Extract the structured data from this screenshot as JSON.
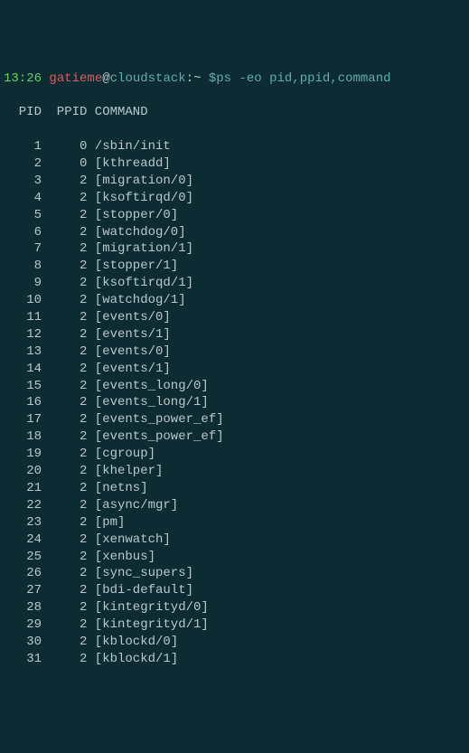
{
  "prompt": {
    "time": "13:26",
    "user": "gatieme",
    "at": "@",
    "host": "cloudstack",
    "path_sep": ":",
    "path": "~",
    "dollar": " $",
    "command": "ps -eo pid,ppid,command"
  },
  "header": {
    "pid": "PID",
    "ppid": "PPID",
    "command": "COMMAND"
  },
  "rows": [
    {
      "pid": "1",
      "ppid": "0",
      "command": "/sbin/init"
    },
    {
      "pid": "2",
      "ppid": "0",
      "command": "[kthreadd]"
    },
    {
      "pid": "3",
      "ppid": "2",
      "command": "[migration/0]"
    },
    {
      "pid": "4",
      "ppid": "2",
      "command": "[ksoftirqd/0]"
    },
    {
      "pid": "5",
      "ppid": "2",
      "command": "[stopper/0]"
    },
    {
      "pid": "6",
      "ppid": "2",
      "command": "[watchdog/0]"
    },
    {
      "pid": "7",
      "ppid": "2",
      "command": "[migration/1]"
    },
    {
      "pid": "8",
      "ppid": "2",
      "command": "[stopper/1]"
    },
    {
      "pid": "9",
      "ppid": "2",
      "command": "[ksoftirqd/1]"
    },
    {
      "pid": "10",
      "ppid": "2",
      "command": "[watchdog/1]"
    },
    {
      "pid": "11",
      "ppid": "2",
      "command": "[events/0]"
    },
    {
      "pid": "12",
      "ppid": "2",
      "command": "[events/1]"
    },
    {
      "pid": "13",
      "ppid": "2",
      "command": "[events/0]"
    },
    {
      "pid": "14",
      "ppid": "2",
      "command": "[events/1]"
    },
    {
      "pid": "15",
      "ppid": "2",
      "command": "[events_long/0]"
    },
    {
      "pid": "16",
      "ppid": "2",
      "command": "[events_long/1]"
    },
    {
      "pid": "17",
      "ppid": "2",
      "command": "[events_power_ef]"
    },
    {
      "pid": "18",
      "ppid": "2",
      "command": "[events_power_ef]"
    },
    {
      "pid": "19",
      "ppid": "2",
      "command": "[cgroup]"
    },
    {
      "pid": "20",
      "ppid": "2",
      "command": "[khelper]"
    },
    {
      "pid": "21",
      "ppid": "2",
      "command": "[netns]"
    },
    {
      "pid": "22",
      "ppid": "2",
      "command": "[async/mgr]"
    },
    {
      "pid": "23",
      "ppid": "2",
      "command": "[pm]"
    },
    {
      "pid": "24",
      "ppid": "2",
      "command": "[xenwatch]"
    },
    {
      "pid": "25",
      "ppid": "2",
      "command": "[xenbus]"
    },
    {
      "pid": "26",
      "ppid": "2",
      "command": "[sync_supers]"
    },
    {
      "pid": "27",
      "ppid": "2",
      "command": "[bdi-default]"
    },
    {
      "pid": "28",
      "ppid": "2",
      "command": "[kintegrityd/0]"
    },
    {
      "pid": "29",
      "ppid": "2",
      "command": "[kintegrityd/1]"
    },
    {
      "pid": "30",
      "ppid": "2",
      "command": "[kblockd/0]"
    },
    {
      "pid": "31",
      "ppid": "2",
      "command": "[kblockd/1]"
    }
  ]
}
